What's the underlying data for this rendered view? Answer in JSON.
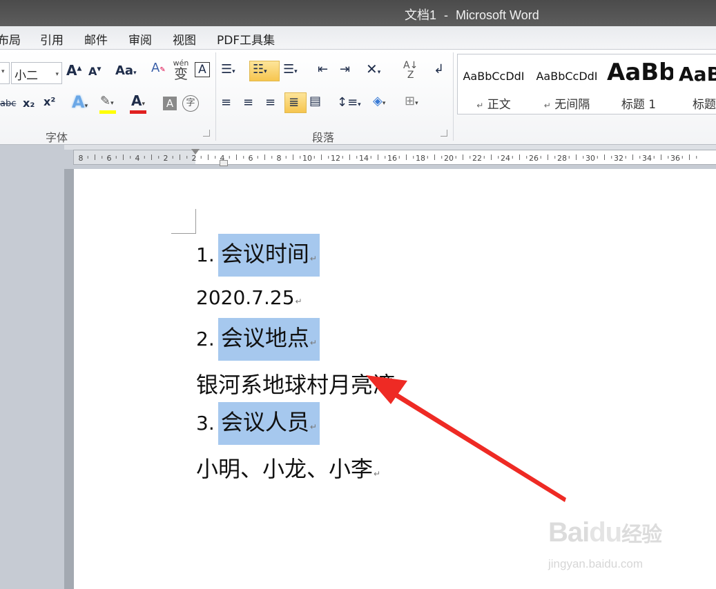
{
  "window": {
    "doc_name": "文档1",
    "sep": "-",
    "app_name": "Microsoft Word"
  },
  "tabs": [
    "布局",
    "引用",
    "邮件",
    "审阅",
    "视图",
    "PDF工具集"
  ],
  "ribbon": {
    "font_size": "小二",
    "font_group_label": "字体",
    "paragraph_group_label": "段落",
    "font_buttons": {
      "grow": "A",
      "shrink": "A",
      "change_case": "Aa",
      "clear_format": "A",
      "phonetic": "wén",
      "phonetic_char": "变",
      "char_border": "A",
      "strike": "abc",
      "subscript": "x₂",
      "superscript": "x²",
      "text_effect": "A",
      "highlight_color": "#ffff00",
      "font_color": "#e02020",
      "font_color_label": "A",
      "char_shading": "A",
      "enclose_char": "字"
    },
    "styles": [
      {
        "sample": "AaBbCcDdI",
        "name": "正文",
        "mark": "↵"
      },
      {
        "sample": "AaBbCcDdI",
        "name": "无间隔",
        "mark": "↵"
      },
      {
        "sample": "AaBb",
        "name": "标题 1",
        "mark": ""
      },
      {
        "sample": "AaB",
        "name": "标题",
        "mark": ""
      }
    ]
  },
  "ruler": {
    "labels": [
      "8",
      "6",
      "4",
      "2",
      "2",
      "4",
      "6",
      "8",
      "10",
      "12",
      "14",
      "16",
      "18",
      "20",
      "22",
      "24",
      "26",
      "28",
      "30",
      "32",
      "34",
      "36"
    ]
  },
  "document": {
    "items": [
      {
        "num": "1.",
        "heading": "会议时间",
        "body": "2020.7.25"
      },
      {
        "num": "2.",
        "heading": "会议地点",
        "body": "银河系地球村月亮湾"
      },
      {
        "num": "3.",
        "heading": "会议人员",
        "body": "小明、小龙、小李"
      }
    ],
    "para_mark": "↵",
    "highlight_color": "#a6c8ee"
  },
  "annotation": {
    "arrow_color": "#ee2a24"
  },
  "watermark": {
    "brand": "Bai",
    "brand2": "du",
    "brand_cn": "经验",
    "url": "jingyan.baidu.com"
  }
}
